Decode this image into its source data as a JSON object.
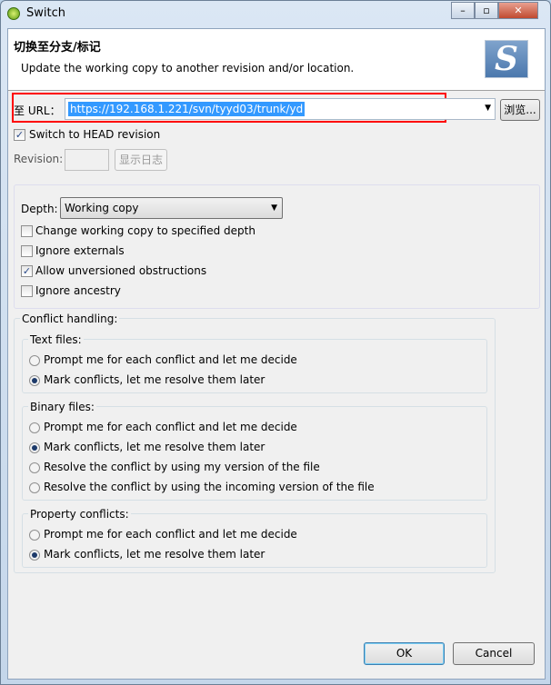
{
  "window": {
    "title": "Switch"
  },
  "header": {
    "title": "切换至分支/标记",
    "subtitle": "Update the working copy to another revision and/or location."
  },
  "url": {
    "label": "至 URL：",
    "value": "https://192.168.1.221/svn/tyyd03/trunk/yd",
    "browse": "浏览..."
  },
  "head_revision": {
    "label": "Switch to HEAD revision",
    "checked": true
  },
  "revision": {
    "label": "Revision:",
    "value": "",
    "show_log": "显示日志"
  },
  "depth": {
    "label": "Depth:",
    "value": "Working copy"
  },
  "options": [
    {
      "label": "Change working copy to specified depth",
      "checked": false
    },
    {
      "label": "Ignore externals",
      "checked": false
    },
    {
      "label": "Allow unversioned obstructions",
      "checked": true
    },
    {
      "label": "Ignore ancestry",
      "checked": false
    }
  ],
  "conflict": {
    "title": "Conflict handling:",
    "text": {
      "title": "Text files:",
      "options": [
        "Prompt me for each conflict and let me decide",
        "Mark conflicts, let me resolve them later"
      ],
      "selected": 1
    },
    "binary": {
      "title": "Binary files:",
      "options": [
        "Prompt me for each conflict and let me decide",
        "Mark conflicts, let me resolve them later",
        "Resolve the conflict by using my version of the file",
        "Resolve the conflict by using the incoming version of the file"
      ],
      "selected": 1
    },
    "property": {
      "title": "Property conflicts:",
      "options": [
        "Prompt me for each conflict and let me decide",
        "Mark conflicts, let me resolve them later"
      ],
      "selected": 1
    }
  },
  "buttons": {
    "ok": "OK",
    "cancel": "Cancel"
  },
  "highlight_color": "#ff0000"
}
